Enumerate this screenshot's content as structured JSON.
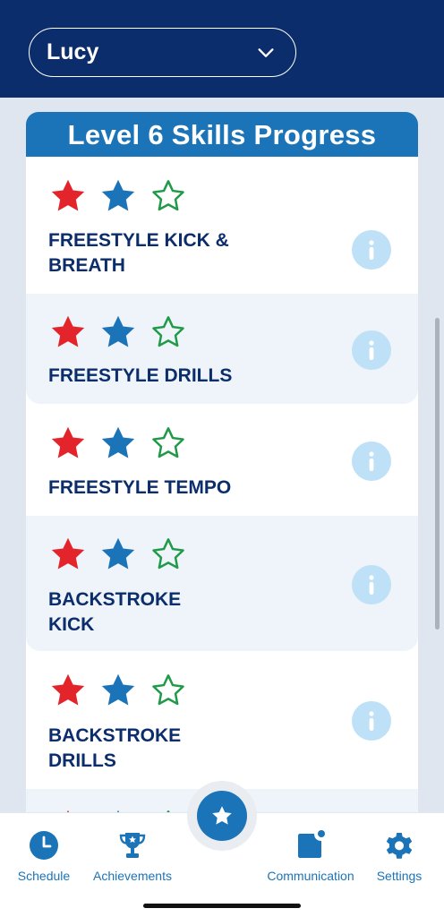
{
  "student_select": {
    "selected": "Lucy"
  },
  "card": {
    "title": "Level 6 Skills Progress"
  },
  "colors": {
    "star_1": "#e3252b",
    "star_2": "#1b74b8",
    "star_3_outline": "#1f9a48",
    "header": "#1b74b8",
    "navy": "#0b2d6b",
    "info": "#bfe1f7"
  },
  "skills": [
    {
      "label": "FREESTYLE KICK &\nBREATH",
      "stars_earned": 2,
      "stars_total": 3
    },
    {
      "label": "FREESTYLE DRILLS",
      "stars_earned": 2,
      "stars_total": 3
    },
    {
      "label": "FREESTYLE TEMPO",
      "stars_earned": 2,
      "stars_total": 3
    },
    {
      "label": "BACKSTROKE\nKICK",
      "stars_earned": 2,
      "stars_total": 3
    },
    {
      "label": "BACKSTROKE\nDRILLS",
      "stars_earned": 2,
      "stars_total": 3
    }
  ],
  "bottom_nav": {
    "schedule": "Schedule",
    "achievements": "Achievements",
    "communication": "Communication",
    "settings": "Settings",
    "center_icon": "star-icon"
  }
}
